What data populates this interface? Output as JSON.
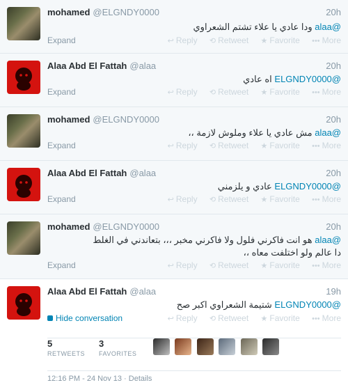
{
  "tweets": [
    {
      "name": "mohamed",
      "handle": "@ELGNDY0000",
      "time": "20h",
      "mention": "@alaa",
      "text": " ودا عادي يا علاء تشتم الشعراوي",
      "expand": "Expand",
      "avatar": "photo"
    },
    {
      "name": "Alaa Abd El Fattah",
      "handle": "@alaa",
      "time": "20h",
      "mention": "@ELGNDY0000",
      "text": " اه عادي",
      "expand": "Expand",
      "avatar": "alaa"
    },
    {
      "name": "mohamed",
      "handle": "@ELGNDY0000",
      "time": "20h",
      "mention": "@alaa",
      "text": " مش عادي يا علاء وملوش لازمة ،،",
      "expand": "Expand",
      "avatar": "photo"
    },
    {
      "name": "Alaa Abd El Fattah",
      "handle": "@alaa",
      "time": "20h",
      "mention": "@ELGNDY0000",
      "text": " عادي و يلزمني",
      "expand": "Expand",
      "avatar": "alaa"
    },
    {
      "name": "mohamed",
      "handle": "@ELGNDY0000",
      "time": "20h",
      "mention": "@alaa",
      "text": " هو انت فاكرني فلول ولا فاكرني مخبر ،،، بتعاندني في الغلط",
      "line2": "دا عالم ولو اختلفت معاه ،،",
      "expand": "Expand",
      "avatar": "photo"
    },
    {
      "name": "Alaa Abd El Fattah",
      "handle": "@alaa",
      "time": "19h",
      "mention": "@ELGNDY0000",
      "text": " شتيمة الشعراوي اكبر صح",
      "expand": "Hide conversation",
      "avatar": "alaa"
    }
  ],
  "actions": {
    "reply": "Reply",
    "retweet": "Retweet",
    "favorite": "Favorite",
    "more": "More"
  },
  "stats": {
    "retweets_count": "5",
    "retweets_label": "RETWEETS",
    "favorites_count": "3",
    "favorites_label": "FAVORITES"
  },
  "footer": "12:16 PM - 24 Nov 13 · Details",
  "colors": {
    "link": "#0084b4",
    "alaa_avatar": "#d4130f",
    "muted": "#8899a6"
  }
}
